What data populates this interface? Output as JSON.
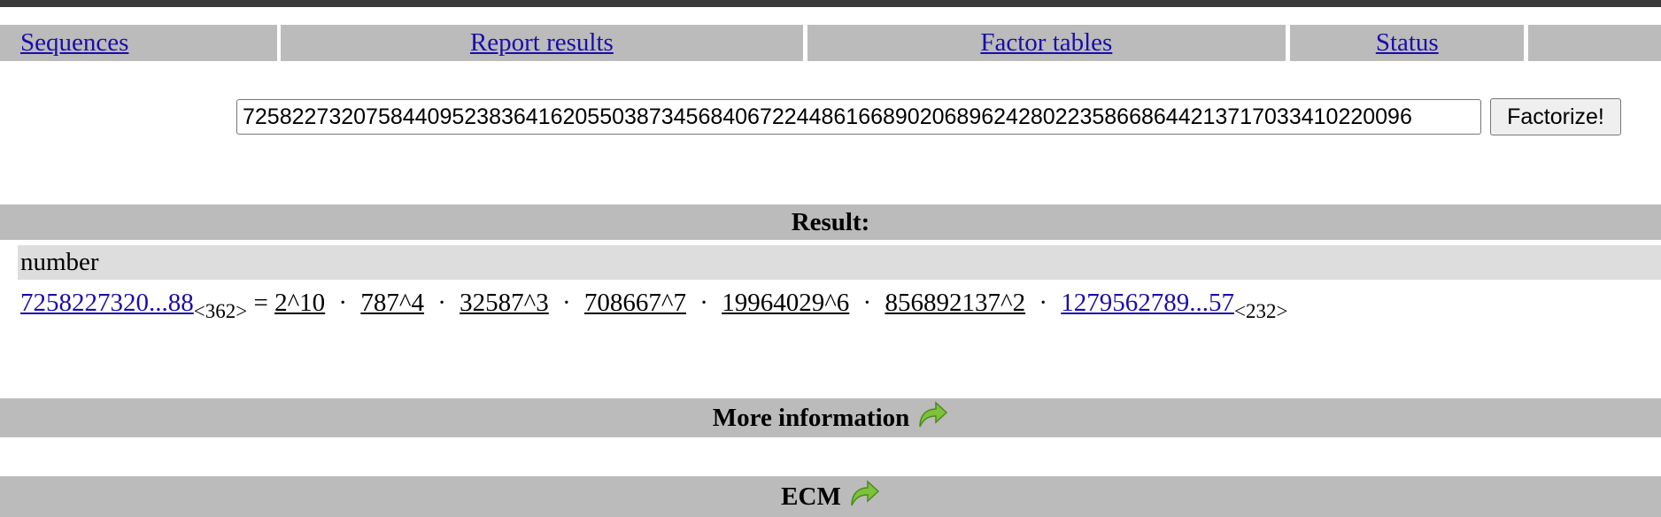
{
  "nav": {
    "items": [
      {
        "label": "Sequences"
      },
      {
        "label": "Report results"
      },
      {
        "label": "Factor tables"
      },
      {
        "label": "Status"
      },
      {
        "label": ""
      }
    ]
  },
  "search": {
    "value": "72582273207584409523836416205503873456840672244861668902068962428022358668644213717033410220096",
    "button_label": "Factorize!"
  },
  "result": {
    "heading": "Result:",
    "column_header": "number",
    "number_short": "7258227320...88",
    "number_digits": "<362>",
    "equals": "=",
    "dot": "·",
    "factors": [
      "2^10",
      "787^4",
      "32587^3",
      "708667^7",
      "19964029^6",
      "856892137^2"
    ],
    "composite_short": "1279562789...57",
    "composite_digits": "<232>"
  },
  "more_info": {
    "heading": "More information",
    "icon": "green-arrow-icon"
  },
  "ecm": {
    "heading": "ECM",
    "icon": "green-arrow-icon"
  },
  "colors": {
    "bar": "#bbbbbb",
    "header_row": "#dddddd",
    "link": "#1a0dab",
    "top_bar": "#3a3a3a"
  }
}
